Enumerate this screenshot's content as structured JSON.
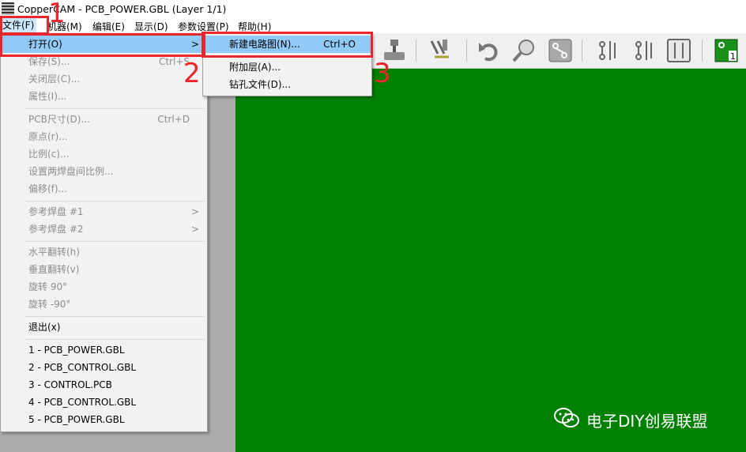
{
  "window": {
    "title": "CopperCAM   -   PCB_POWER.GBL    (Layer 1/1)"
  },
  "menubar": {
    "items": [
      "文件(F)",
      "机器(M)",
      "编辑(E)",
      "显示(D)",
      "参数设置(P)",
      "帮助(H)"
    ]
  },
  "file_menu": {
    "open": {
      "label": "打开(O)",
      "arrow": ">"
    },
    "save": {
      "label": "保存(S)...",
      "shortcut": "Ctrl+S"
    },
    "close_layer": "关闭层(C)...",
    "properties": "属性(I)...",
    "pcb_size": {
      "label": "PCB尺寸(D)...",
      "shortcut": "Ctrl+D"
    },
    "origin": "原点(r)...",
    "scale": "比例(c)...",
    "pad_scale": "设置两焊盘间比例...",
    "offset": "偏移(f)...",
    "ref_pad1": {
      "label": "参考焊盘 #1",
      "arrow": ">"
    },
    "ref_pad2": {
      "label": "参考焊盘 #2",
      "arrow": ">"
    },
    "flip_h": "水平翻转(h)",
    "flip_v": "垂直翻转(v)",
    "rot_90": "旋转 90°",
    "rot_m90": "旋转 -90°",
    "exit": "退出(x)",
    "recent": [
      "1 - PCB_POWER.GBL",
      "2 - PCB_CONTROL.GBL",
      "3 - CONTROL.PCB",
      "4 - PCB_CONTROL.GBL",
      "5 - PCB_POWER.GBL"
    ]
  },
  "open_submenu": {
    "new_circuit": {
      "label": "新建电路图(N)...",
      "shortcut": "Ctrl+O"
    },
    "add_layer": "附加层(A)...",
    "drill_file": "钻孔文件(D)..."
  },
  "annotations": {
    "step1": "1",
    "step2": "2",
    "step3": "3"
  },
  "watermark": {
    "text": "电子DIY创易联盟"
  },
  "colors": {
    "canvas": "#008000",
    "highlight": "#91c9f7",
    "annotation": "#e8262b"
  }
}
